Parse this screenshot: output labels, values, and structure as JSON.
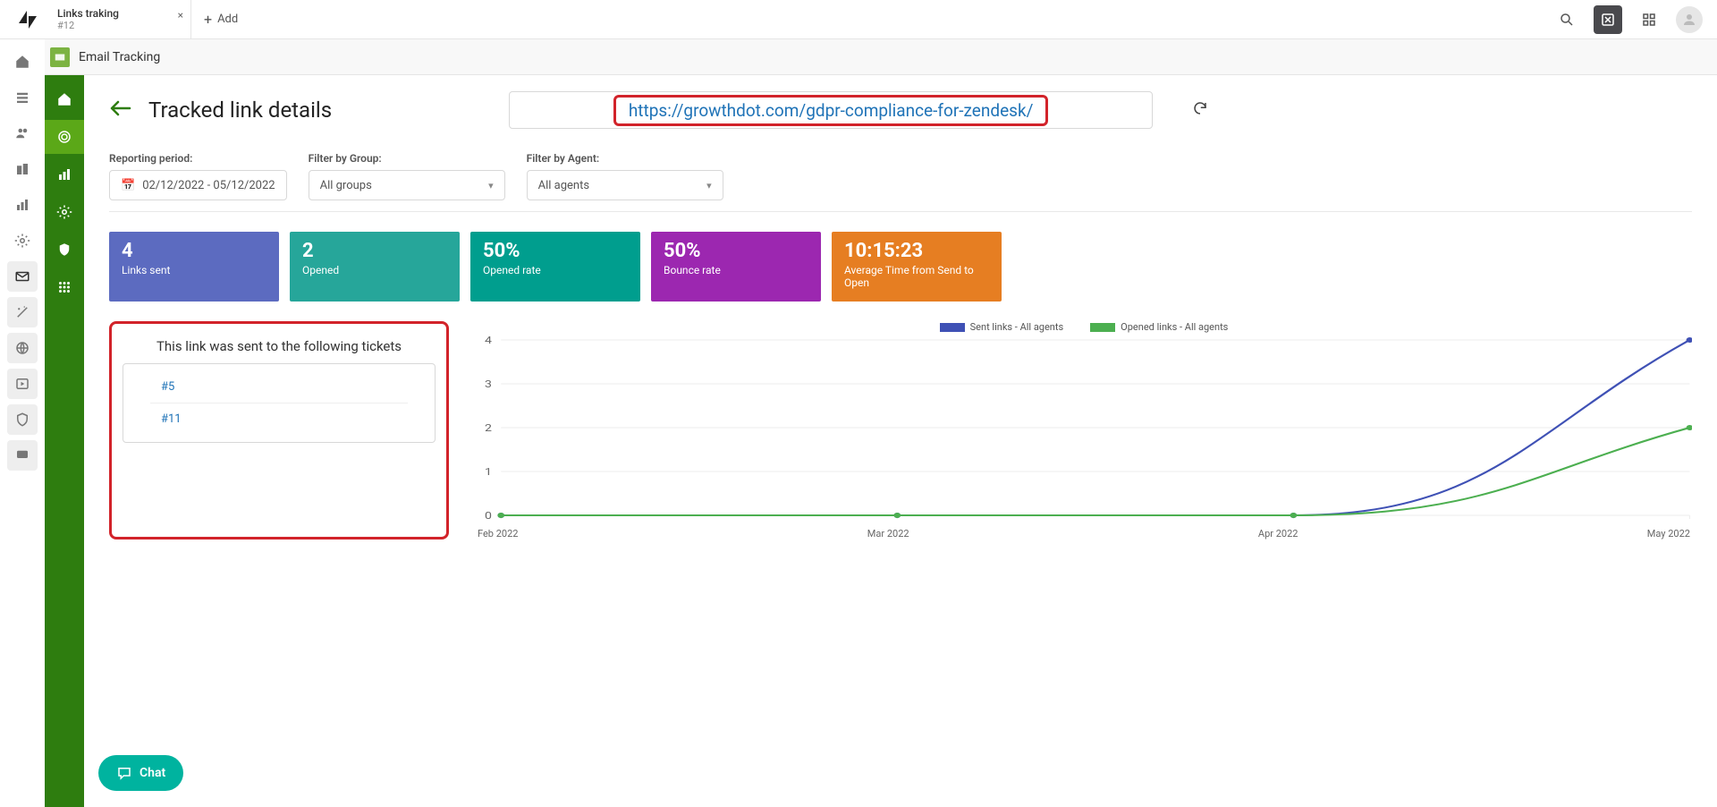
{
  "topbar": {
    "tab_title": "Links traking",
    "tab_sub": "#12",
    "add_label": "Add"
  },
  "app_header": {
    "title": "Email Tracking"
  },
  "page": {
    "title": "Tracked link details",
    "url": "https://growthdot.com/gdpr-compliance-for-zendesk/"
  },
  "filters": {
    "period_label": "Reporting period:",
    "period_value": "02/12/2022 - 05/12/2022",
    "group_label": "Filter by Group:",
    "group_value": "All groups",
    "agent_label": "Filter by Agent:",
    "agent_value": "All agents"
  },
  "stats": [
    {
      "value": "4",
      "label": "Links sent",
      "cls": "c-blue"
    },
    {
      "value": "2",
      "label": "Opened",
      "cls": "c-green"
    },
    {
      "value": "50%",
      "label": "Opened rate",
      "cls": "c-teal"
    },
    {
      "value": "50%",
      "label": "Bounce rate",
      "cls": "c-purple"
    },
    {
      "value": "10:15:23",
      "label": "Average Time from Send to Open",
      "cls": "c-orange"
    }
  ],
  "tickets": {
    "title": "This link was sent to the following tickets",
    "items": [
      "#5",
      "#11"
    ]
  },
  "chart_legend": {
    "sent": "Sent links - All agents",
    "opened": "Opened links - All agents"
  },
  "chart_data": {
    "type": "line",
    "x": [
      "Feb 2022",
      "Mar 2022",
      "Apr 2022",
      "May 2022"
    ],
    "ylim": [
      0,
      4
    ],
    "yticks": [
      0,
      1,
      2,
      3,
      4
    ],
    "series": [
      {
        "name": "Sent links - All agents",
        "color": "#3f51b5",
        "values": [
          0,
          0,
          0,
          4
        ]
      },
      {
        "name": "Opened links - All agents",
        "color": "#4caf50",
        "values": [
          0,
          0,
          0,
          2
        ]
      }
    ]
  },
  "chat": {
    "label": "Chat"
  }
}
